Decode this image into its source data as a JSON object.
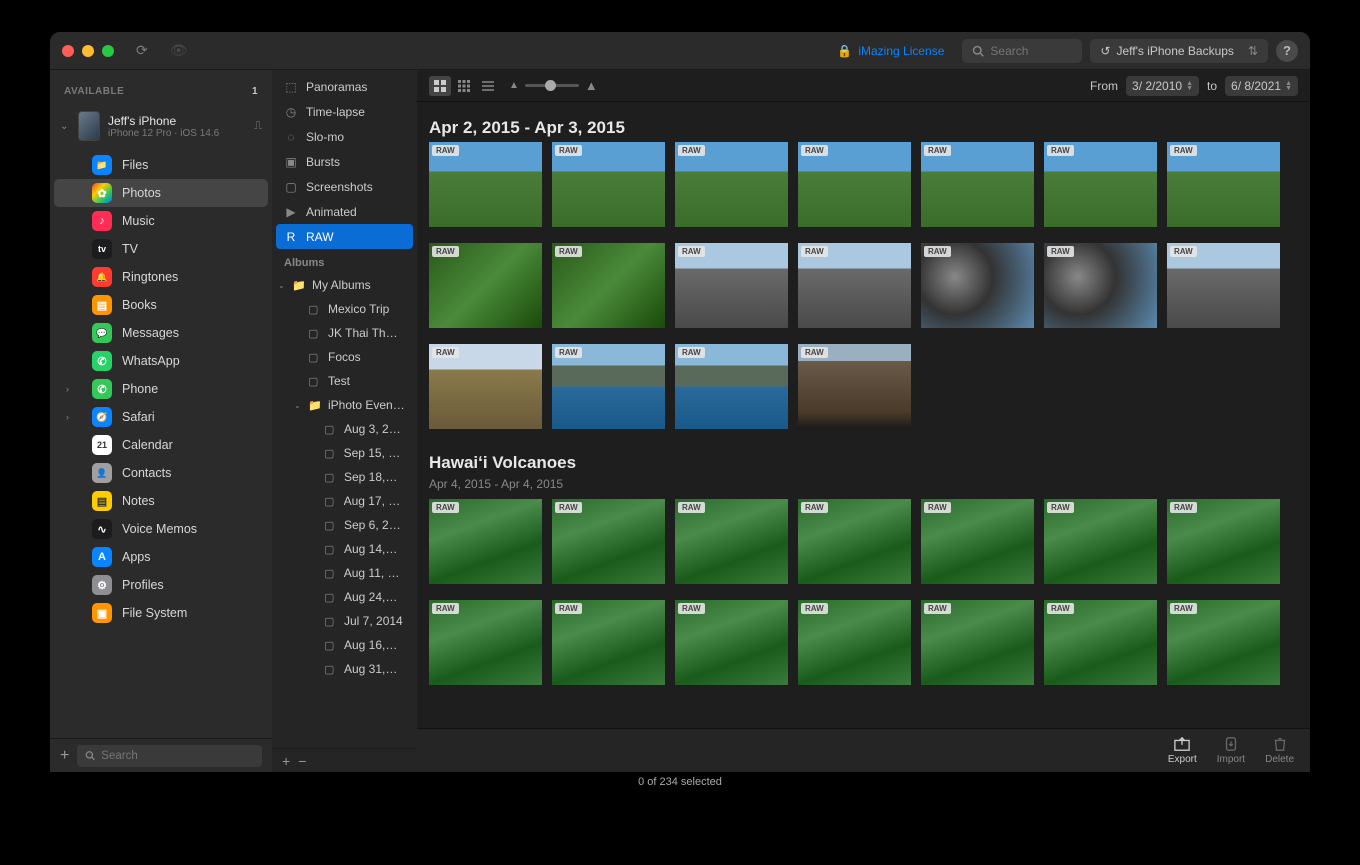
{
  "titlebar": {
    "license_label": "iMazing License",
    "search_placeholder": "Search",
    "backup_label": "Jeff's iPhone Backups"
  },
  "sidebar1": {
    "header": "AVAILABLE",
    "count": "1",
    "device": {
      "name": "Jeff's iPhone",
      "sub": "iPhone 12 Pro · iOS 14.6"
    },
    "items": [
      {
        "label": "Files",
        "color": "#0a84ff",
        "emoji": "📁"
      },
      {
        "label": "Photos",
        "color": "linear-gradient(135deg,#ff3b30,#ffcc00,#34c759,#007aff)",
        "emoji": "✿",
        "selected": true
      },
      {
        "label": "Music",
        "color": "#ff2d55",
        "emoji": "♪"
      },
      {
        "label": "TV",
        "color": "#1c1c1e",
        "emoji": "tv"
      },
      {
        "label": "Ringtones",
        "color": "#ff3b30",
        "emoji": "🔔"
      },
      {
        "label": "Books",
        "color": "#ff9500",
        "emoji": "▤"
      },
      {
        "label": "Messages",
        "color": "#34c759",
        "emoji": "💬"
      },
      {
        "label": "WhatsApp",
        "color": "#25d366",
        "emoji": "✆"
      },
      {
        "label": "Phone",
        "color": "#34c759",
        "emoji": "✆",
        "chev": true
      },
      {
        "label": "Safari",
        "color": "#0a84ff",
        "emoji": "🧭",
        "chev": true
      },
      {
        "label": "Calendar",
        "color": "#ffffff",
        "emoji": "21"
      },
      {
        "label": "Contacts",
        "color": "#a0a0a0",
        "emoji": "👤"
      },
      {
        "label": "Notes",
        "color": "#ffcc00",
        "emoji": "▤"
      },
      {
        "label": "Voice Memos",
        "color": "#1c1c1e",
        "emoji": "∿"
      },
      {
        "label": "Apps",
        "color": "#0a84ff",
        "emoji": "A"
      },
      {
        "label": "Profiles",
        "color": "#8e8e93",
        "emoji": "⚙"
      },
      {
        "label": "File System",
        "color": "#ff9500",
        "emoji": "▣"
      }
    ],
    "footer_search_placeholder": "Search"
  },
  "sidebar2": {
    "mediatypes": [
      {
        "label": "Panoramas",
        "icon": "⬚"
      },
      {
        "label": "Time-lapse",
        "icon": "◷"
      },
      {
        "label": "Slo-mo",
        "icon": "◌"
      },
      {
        "label": "Bursts",
        "icon": "▣"
      },
      {
        "label": "Screenshots",
        "icon": "▢"
      },
      {
        "label": "Animated",
        "icon": "▶"
      },
      {
        "label": "RAW",
        "icon": "R",
        "selected": true
      }
    ],
    "albums_header": "Albums",
    "albums": [
      {
        "label": "My Albums",
        "folder": true,
        "expanded": true,
        "level": 0
      },
      {
        "label": "Mexico Trip",
        "level": 1
      },
      {
        "label": "JK Thai Th…",
        "level": 1
      },
      {
        "label": "Focos",
        "level": 1
      },
      {
        "label": "Test",
        "level": 1
      },
      {
        "label": "iPhoto Even…",
        "folder": true,
        "expanded": true,
        "level": 1
      },
      {
        "label": "Aug 3, 2…",
        "level": 2
      },
      {
        "label": "Sep 15, 2…",
        "level": 2
      },
      {
        "label": "Sep 18,…",
        "level": 2
      },
      {
        "label": "Aug 17, 2…",
        "level": 2
      },
      {
        "label": "Sep 6, 2…",
        "level": 2
      },
      {
        "label": "Aug 14,…",
        "level": 2
      },
      {
        "label": "Aug 11, 2…",
        "level": 2
      },
      {
        "label": "Aug 24,…",
        "level": 2
      },
      {
        "label": "Jul 7, 2014",
        "level": 2
      },
      {
        "label": "Aug 16,…",
        "level": 2
      },
      {
        "label": "Aug 31,…",
        "level": 2
      }
    ]
  },
  "toolbar": {
    "from_label": "From",
    "to_label": "to",
    "date_from": "3/  2/2010",
    "date_to": "6/  8/2021"
  },
  "sections": [
    {
      "title": "Apr 2, 2015 - Apr 3, 2015",
      "rows": [
        [
          "grass",
          "grass",
          "grass",
          "grass",
          "grass",
          "grass",
          "grass"
        ],
        [
          "leaf",
          "leaf",
          "road",
          "road",
          "mirror",
          "mirror",
          "road"
        ],
        [
          "hill",
          "ocean",
          "ocean",
          "volcanic"
        ]
      ]
    },
    {
      "title": "Hawaiʻi Volcanoes",
      "sub": "Apr 4, 2015 - Apr 4, 2015",
      "rows": [
        [
          "jungle",
          "jungle",
          "jungle",
          "jungle",
          "jungle",
          "jungle",
          "jungle"
        ],
        [
          "jungle",
          "jungle",
          "jungle",
          "jungle",
          "jungle",
          "jungle",
          "jungle"
        ]
      ]
    }
  ],
  "badge": "RAW",
  "bottom": {
    "export": "Export",
    "import": "Import",
    "delete": "Delete"
  },
  "status": "0 of 234 selected"
}
